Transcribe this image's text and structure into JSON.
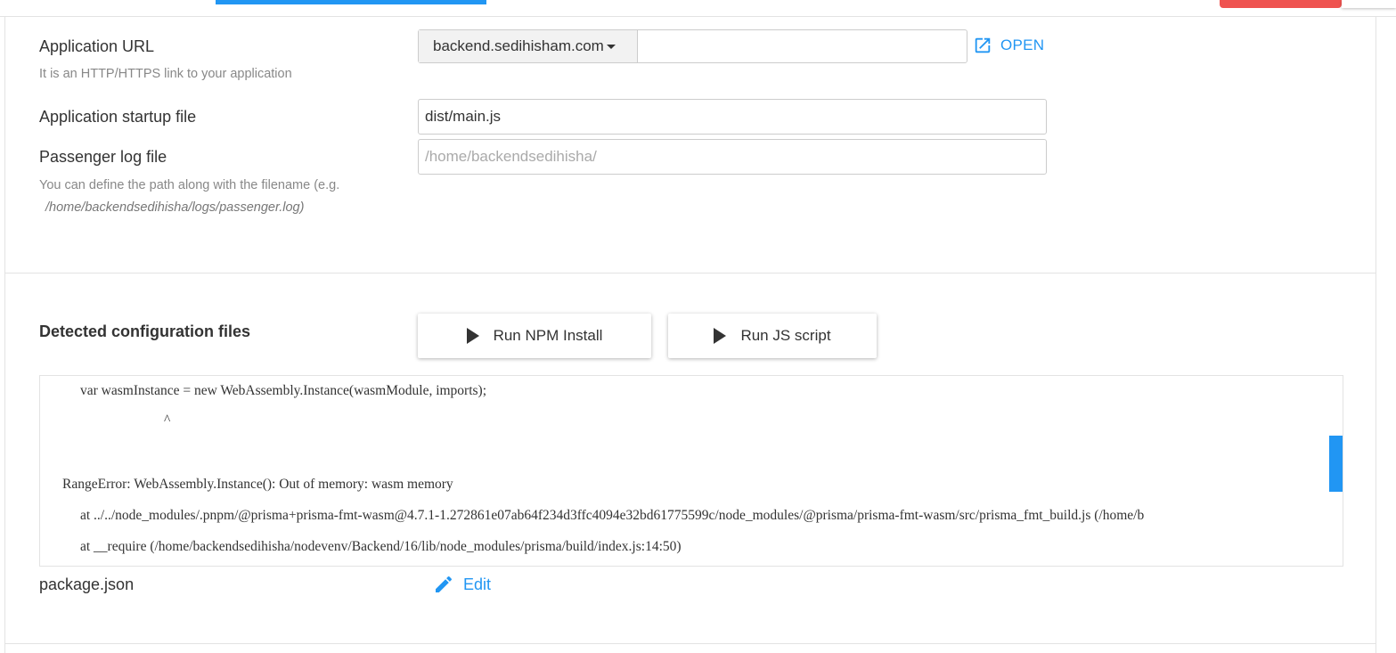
{
  "app_url": {
    "label": "Application URL",
    "hint": "It is an HTTP/HTTPS link to your application",
    "domain": "backend.sedihisham.com",
    "path_value": "",
    "open_label": "OPEN"
  },
  "startup_file": {
    "label": "Application startup file",
    "value": "dist/main.js"
  },
  "log_file": {
    "label": "Passenger log file",
    "placeholder": "/home/backendsedihisha/",
    "hint_line1": "You can define the path along with the filename (e.g.",
    "hint_line2": "/home/backendsedihisha/logs/passenger.log)"
  },
  "config": {
    "heading": "Detected configuration files",
    "run_npm_label": "Run NPM Install",
    "run_js_label": "Run JS script"
  },
  "console": {
    "lines": [
      "var wasmInstance = new WebAssembly.Instance(wasmModule, imports);",
      "^",
      "RangeError: WebAssembly.Instance(): Out of memory: wasm memory",
      "at ../../node_modules/.pnpm/@prisma+prisma-fmt-wasm@4.7.1-1.272861e07ab64f234d3ffc4094e32bd61775599c/node_modules/@prisma/prisma-fmt-wasm/src/prisma_fmt_build.js (/home/b",
      "at __require (/home/backendsedihisha/nodevenv/Backend/16/lib/node_modules/prisma/build/index.js:14:50)"
    ]
  },
  "package_file": {
    "name": "package.json",
    "edit_label": "Edit"
  },
  "colors": {
    "accent": "#2196f3",
    "danger": "#ef5350"
  }
}
